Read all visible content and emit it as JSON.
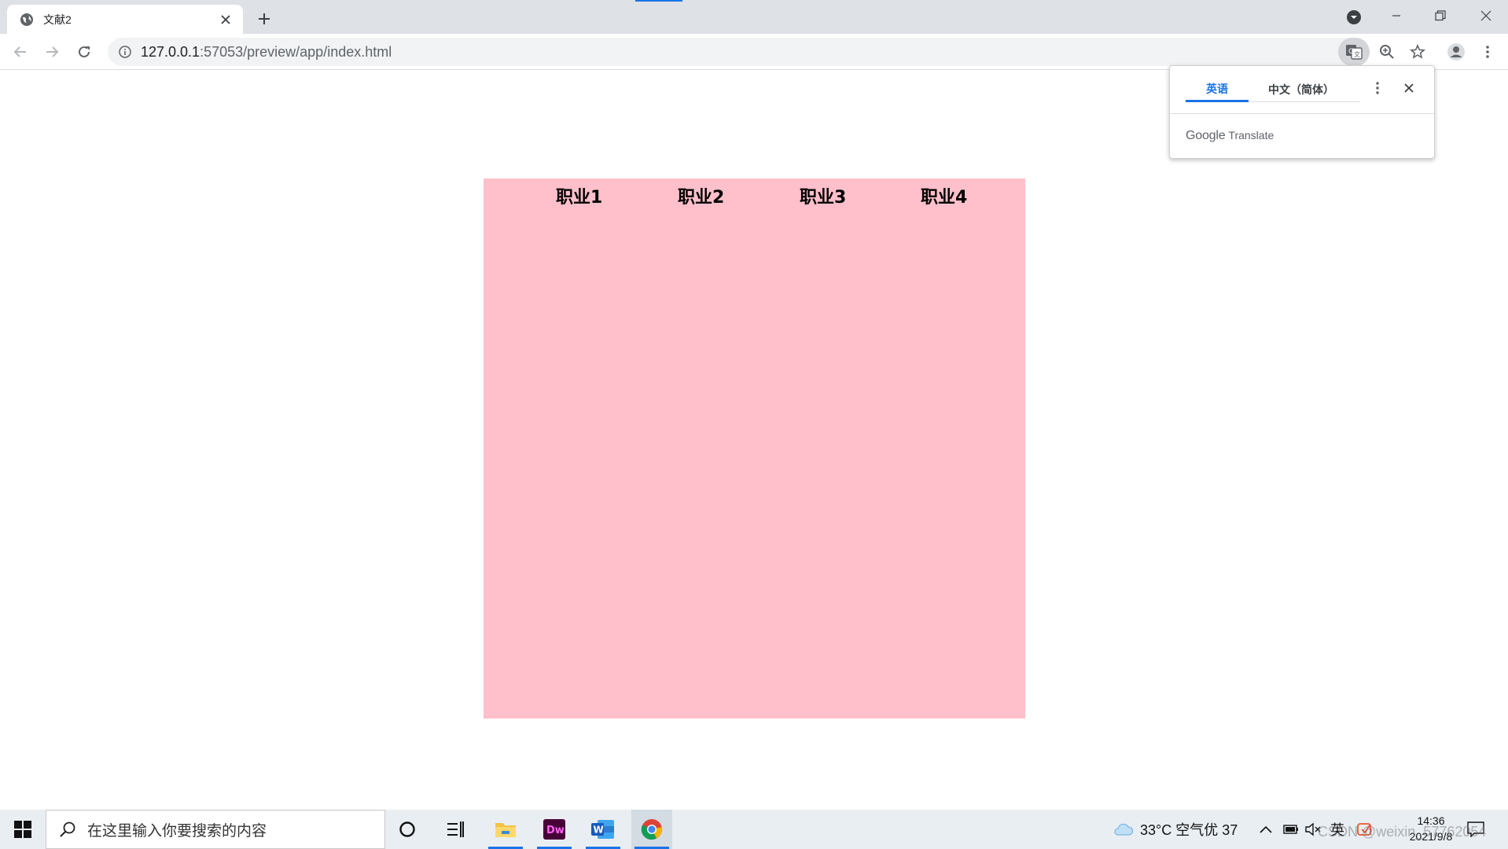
{
  "browser": {
    "tab_title": "文献2",
    "url_host": "127.0.0.1",
    "url_rest": ":57053/preview/app/index.html"
  },
  "translate_popup": {
    "tab_source": "英语",
    "tab_target": "中文（简体）",
    "brand_google": "Google",
    "brand_translate": "Translate"
  },
  "page": {
    "background_color": "#ffc0cb",
    "jobs": [
      "职业1",
      "职业2",
      "职业3",
      "职业4"
    ]
  },
  "taskbar": {
    "search_placeholder": "在这里输入你要搜索的内容",
    "weather": "33°C 空气优 37",
    "time": "14:36",
    "date": "2021/9/8",
    "ime": "英",
    "apps": [
      "file-explorer",
      "dreamweaver",
      "word",
      "chrome"
    ],
    "dw_label": "Dw",
    "word_label": "W"
  },
  "watermark": "CSDN @weixin_57762054"
}
